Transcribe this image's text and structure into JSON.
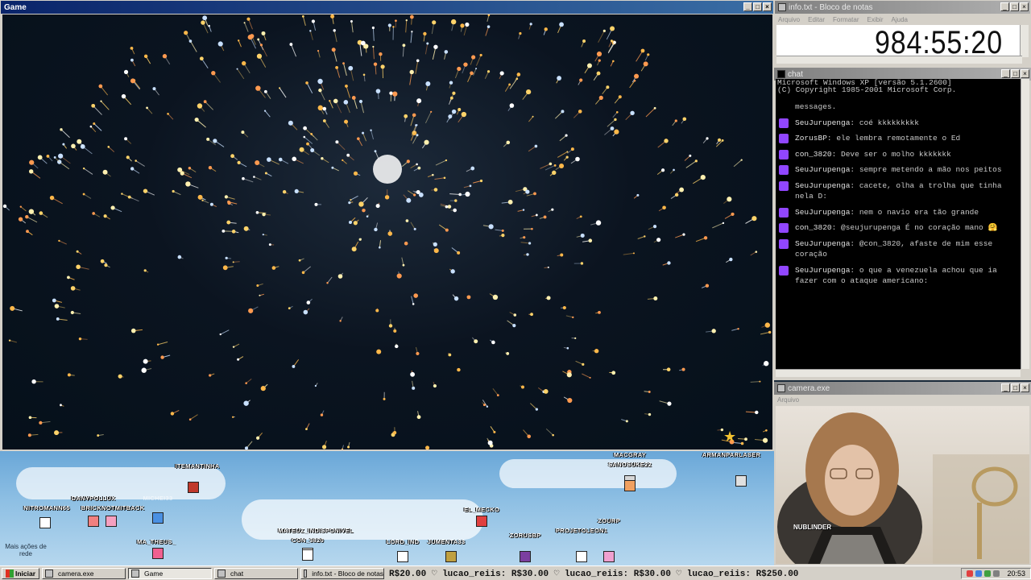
{
  "game": {
    "title": "Game",
    "buttons": [
      "_",
      "□",
      "×"
    ]
  },
  "notepad": {
    "title": "info.txt - Bloco de notas",
    "menu": [
      "Arquivo",
      "Editar",
      "Formatar",
      "Exibir",
      "Ajuda"
    ],
    "timer": "984:55:20"
  },
  "chat": {
    "title": "chat",
    "header_lines": [
      "Microsoft Windows XP [versão 5.1.2600]",
      "(C) Copyright 1985-2001 Microsoft Corp."
    ],
    "intro": "messages.",
    "messages": [
      {
        "user": "SeuJurupenga",
        "text": "coé kkkkkkkkk"
      },
      {
        "user": "ZorusBP",
        "text": "ele lembra remotamente o Ed"
      },
      {
        "user": "con_3820",
        "text": "Deve ser o molho kkkkkkk"
      },
      {
        "user": "SeuJurupenga",
        "text": "sempre metendo a mão nos peitos"
      },
      {
        "user": "SeuJurupenga",
        "text": "cacete, olha a trolha que tinha nela D:"
      },
      {
        "user": "SeuJurupenga",
        "text": "nem o navio era tão grande"
      },
      {
        "user": "con_3820",
        "text": "@seujurupenga É no coração mano 🤗"
      },
      {
        "user": "SeuJurupenga",
        "text": "@con_3820, afaste de mim esse coração"
      },
      {
        "user": "SeuJurupenga",
        "text": "o que a venezuela achou que ia fazer com o ataque americano:"
      }
    ]
  },
  "camera": {
    "title": "camera.exe",
    "menu": "Arquivo",
    "name_tag": "NUBLINDER"
  },
  "lobby": {
    "hint": "Mais ações de rede",
    "players": [
      {
        "name": "ITEMANTINHA",
        "color": "#c0392b"
      },
      {
        "name": "MACGRAY",
        "color": "#d6d6d6"
      },
      {
        "name": "SANOSUKE22",
        "color": "#f0a060"
      },
      {
        "name": "ARMANPARLASER",
        "color": "#e0e0e0"
      },
      {
        "name": "NITROMANN65",
        "color": "#ffffff"
      },
      {
        "name": "DANYPOLLUX",
        "color": "#f08080"
      },
      {
        "name": "BRICKNOTMITBACK",
        "color": "#f5a0c0"
      },
      {
        "name": "MICHEI33",
        "color": "#4a90e2"
      },
      {
        "name": "MA_THEUS_",
        "color": "#f06090"
      },
      {
        "name": "EL_MECKO",
        "color": "#e04040"
      },
      {
        "name": "ZOURP",
        "color": "#ffffff"
      },
      {
        "name": "PROJETOLEON1",
        "color": "#f0a0d0"
      },
      {
        "name": "MATEUZ_INDISPONIVEL",
        "color": "#ffffff"
      },
      {
        "name": "CON_3820",
        "color": "#ffffff"
      },
      {
        "name": "LORD_IND",
        "color": "#ffffff"
      },
      {
        "name": "JUMENTA33",
        "color": "#c0a040"
      },
      {
        "name": "ZORUSBP",
        "color": "#7b3fa0"
      }
    ]
  },
  "taskbar": {
    "start": "Iniciar",
    "tasks": [
      {
        "label": "camera.exe",
        "active": false
      },
      {
        "label": "Game",
        "active": true
      },
      {
        "label": "chat",
        "active": false
      },
      {
        "label": "info.txt - Bloco de notas",
        "active": false
      }
    ],
    "ticker": "R$20.00   ♡ lucao_reiis: R$30.00   ♡ lucao_reiis: R$30.00   ♡ lucao_reiis: R$250.00",
    "clock": "20:53"
  }
}
